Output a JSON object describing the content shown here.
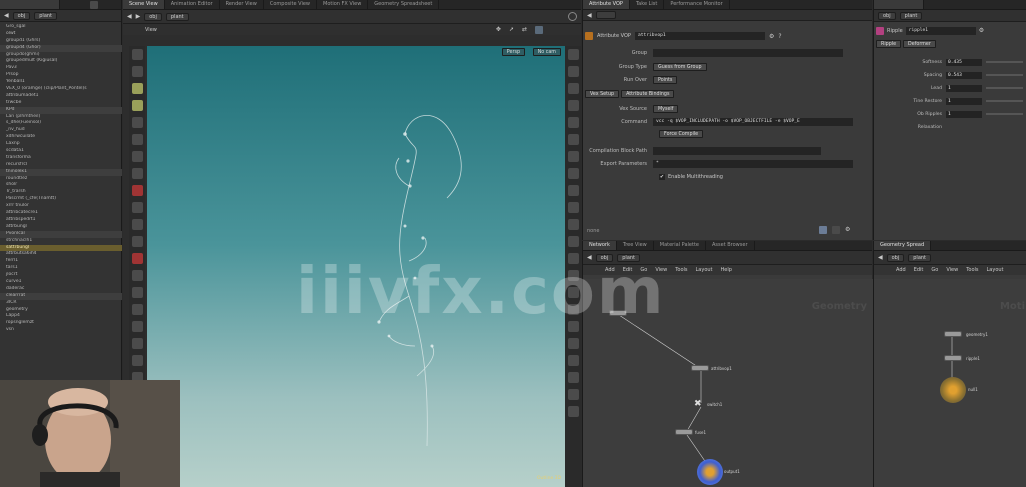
{
  "tree_panel": {
    "path": [
      "obj",
      "plant"
    ],
    "items": [
      "Gro_sgal",
      "olwt",
      "groupd1 (Ghrs)",
      "groupd4 (Ghor)",
      "groupdo(ghmi)",
      "groupedmult (Kigiusal)",
      "Pav3",
      "Prsop",
      "Yenball1",
      "VEX_0 (oramge) (clip/Plant_Pontel)s",
      "attribumadet1",
      "trwcbe",
      "KPd",
      "Lan (plhmtheil)",
      "s_dhe(Fueinsol)",
      "_nv_hud",
      "xdhrwcuilate",
      "Laxnp",
      "scdata1",
      "transforma",
      "recursfrcl",
      "tninolex1",
      "roundtlez",
      "sholr",
      "Tr_trarsh",
      "Pascrmt (_cfe(Tnamtt)",
      "xrrr tnulor",
      "attribcatecre1",
      "attribspedrt1",
      "attrbungl",
      "Pvonlcal",
      "strchnaclh1",
      "sattrbungl",
      "attrbutsa6ih4",
      "ferrl1",
      "tars1",
      "jlocrt",
      "curve1",
      "daderac",
      "clearrrat",
      "3ICR",
      "geometry",
      "Lapp4",
      "ropsnglemzt",
      "vsn"
    ],
    "selected_index": 32
  },
  "viewport": {
    "tabs": [
      "Scene View",
      "Animation Editor",
      "Render View",
      "Composite View",
      "Motion FX View",
      "Geometry Spreadsheet"
    ],
    "path": [
      "obj",
      "plant"
    ],
    "view_label": "View",
    "persp_label": "Persp",
    "cam_label": "No cam",
    "corner_label": "Outline 3D"
  },
  "param_panel": {
    "tabs": [
      "Attribute VOP",
      "Take List",
      "Performance Monitor"
    ],
    "node_type": "Attribute VOP",
    "node_name": "attribvop1",
    "group_label": "Group",
    "group_type_label": "Group Type",
    "group_type_value": "Guess from Group",
    "run_over_label": "Run Over",
    "run_over_value": "Points",
    "subtabs": [
      "Vex Setup",
      "Attribute Bindings"
    ],
    "vex_source_label": "Vex Source",
    "vex_source_value": "Myself",
    "cmd_label": "Command",
    "cmd_value": "vcc -q $VOP_INCLUDEPATH -o $VOP_OBJECTFILE -e $VOP_E",
    "force_compile": "Force Compile",
    "compiler_label": "Compilation Block Path",
    "export_label": "Export Parameters",
    "export_value": "*",
    "multithreading": "Enable Multithreading",
    "footer_label": "none"
  },
  "fr_panel": {
    "path": [
      "obj",
      "plant"
    ],
    "node_type": "Ripple",
    "node_name": "ripple1",
    "tabs": [
      "Ripple",
      "Deformer"
    ],
    "rows": [
      {
        "label": "Softness",
        "value": "0.435"
      },
      {
        "label": "Spacing",
        "value": "0.543"
      },
      {
        "label": "Lead",
        "value": "1"
      },
      {
        "label": "Tine Restore",
        "value": "1"
      },
      {
        "label": "Ob Ripples",
        "value": "1"
      },
      {
        "label": "Relaxation",
        "value": ""
      }
    ]
  },
  "net_panel": {
    "tabs": [
      "Network",
      "Tree View",
      "Material Palette",
      "Asset Browser"
    ],
    "path": [
      "obj",
      "plant"
    ],
    "menu": [
      "Add",
      "Edit",
      "Go",
      "View",
      "Tools",
      "Layout",
      "Help"
    ],
    "label": "Geometry",
    "nodes": [
      "attribvop1",
      "switch1",
      "fuse1",
      "output1"
    ]
  },
  "net2_panel": {
    "tabs": [
      "Geometry Spread"
    ],
    "path": [
      "obj",
      "plant"
    ],
    "menu": [
      "Add",
      "Edit",
      "Go",
      "View",
      "Tools",
      "Layout"
    ],
    "label": "Moti",
    "nodes": [
      "geometry1",
      "ripple1",
      "null1"
    ]
  },
  "watermark": "iiivfx.com",
  "colors": {
    "selection": "#6a5e2e",
    "viewport_top": "#1f6f78",
    "viewport_bottom": "#b6d0ca",
    "output_node": "#3f5fd0"
  }
}
